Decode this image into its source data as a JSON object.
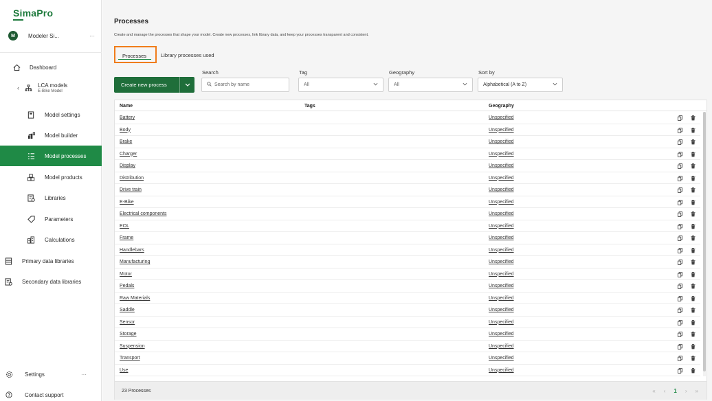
{
  "app": {
    "logo": "SimaPro"
  },
  "user": {
    "initial": "M",
    "name": "Modeler Si...",
    "more": "···"
  },
  "sidebar": {
    "items": [
      {
        "label": "Dashboard"
      },
      {
        "label": "LCA models",
        "sublabel": "E-Bike Model"
      },
      {
        "label": "Model settings"
      },
      {
        "label": "Model builder"
      },
      {
        "label": "Model processes"
      },
      {
        "label": "Model products"
      },
      {
        "label": "Libraries"
      },
      {
        "label": "Parameters"
      },
      {
        "label": "Calculations"
      },
      {
        "label": "Primary data libraries"
      },
      {
        "label": "Secondary data libraries"
      }
    ],
    "settings": {
      "label": "Settings",
      "more": "···"
    },
    "support": {
      "label": "Contact support"
    }
  },
  "page": {
    "title": "Processes",
    "description": "Create and manage the processes that shape your model. Create new processes, link library data, and keep your processes transparent and consistent."
  },
  "tabs": [
    {
      "label": "Processes"
    },
    {
      "label": "Library processes used"
    }
  ],
  "toolbar": {
    "create_label": "Create new process",
    "search_label": "Search",
    "search_placeholder": "Search by name",
    "tag_label": "Tag",
    "tag_value": "All",
    "geography_label": "Geography",
    "geography_value": "All",
    "sort_label": "Sort by",
    "sort_value": "Alphabetical (A to Z)"
  },
  "table": {
    "headers": {
      "name": "Name",
      "tags": "Tags",
      "geography": "Geography"
    },
    "rows": [
      {
        "name": "Battery",
        "geography": "Unspecified"
      },
      {
        "name": "Body",
        "geography": "Unspecified"
      },
      {
        "name": "Brake",
        "geography": "Unspecified"
      },
      {
        "name": "Charger",
        "geography": "Unspecified"
      },
      {
        "name": "Display",
        "geography": "Unspecified"
      },
      {
        "name": "Distribution",
        "geography": "Unspecified"
      },
      {
        "name": "Drive train",
        "geography": "Unspecified"
      },
      {
        "name": "E-Bike",
        "geography": "Unspecified"
      },
      {
        "name": "Electrical components",
        "geography": "Unspecified"
      },
      {
        "name": "EOL",
        "geography": "Unspecified"
      },
      {
        "name": "Frame",
        "geography": "Unspecified"
      },
      {
        "name": "Handlebars",
        "geography": "Unspecified"
      },
      {
        "name": "Manufacturing",
        "geography": "Unspecified"
      },
      {
        "name": "Motor",
        "geography": "Unspecified"
      },
      {
        "name": "Pedals",
        "geography": "Unspecified"
      },
      {
        "name": "Raw Materials",
        "geography": "Unspecified"
      },
      {
        "name": "Saddle",
        "geography": "Unspecified"
      },
      {
        "name": "Sensor",
        "geography": "Unspecified"
      },
      {
        "name": "Storage",
        "geography": "Unspecified"
      },
      {
        "name": "Suspension",
        "geography": "Unspecified"
      },
      {
        "name": "Transport",
        "geography": "Unspecified"
      },
      {
        "name": "Use",
        "geography": "Unspecified"
      }
    ],
    "footer_count": "23 Processes"
  },
  "pagination": {
    "first": "«",
    "prev": "‹",
    "current": "1",
    "next": "›",
    "last": "»"
  },
  "colors": {
    "brand_green": "#1f8a46",
    "highlight_orange": "#f07c1a"
  }
}
